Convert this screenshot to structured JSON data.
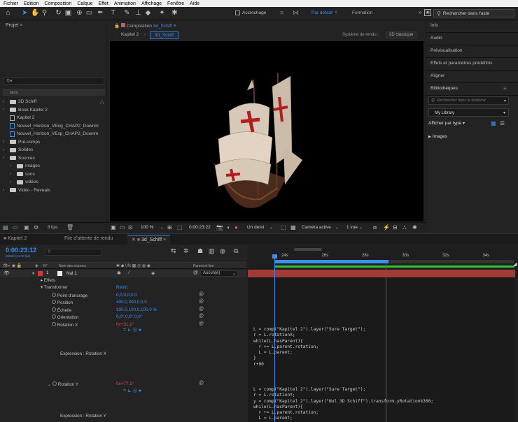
{
  "menu": [
    "Fichier",
    "Edition",
    "Composition",
    "Calque",
    "Effet",
    "Animation",
    "Affichage",
    "Fenêtre",
    "Aide"
  ],
  "toolbar": {
    "snap_label": "Accrochage",
    "workspace_default": "Par défaut",
    "workspace_formation": "Formation",
    "search_placeholder": "Rechercher dans l'aide"
  },
  "project": {
    "title": "Projet",
    "col_name": "Nom",
    "items": [
      {
        "label": "3D Schiff",
        "type": "folder"
      },
      {
        "label": "Book Kapitel 2",
        "type": "folder"
      },
      {
        "label": "Kapitel 2",
        "type": "comp"
      },
      {
        "label": "Nouvel_Horizon_VEng_CHAP2_Downm",
        "type": "file"
      },
      {
        "label": "Nouvel_Horizon_VEsp_CHAP2_Downm",
        "type": "file"
      },
      {
        "label": "Pré-comps",
        "type": "folder"
      },
      {
        "label": "Solides",
        "type": "folder"
      },
      {
        "label": "Sources",
        "type": "folder"
      },
      {
        "label": "images",
        "type": "subfolder"
      },
      {
        "label": "sons",
        "type": "subfolder"
      },
      {
        "label": "vidéos",
        "type": "subfolder"
      },
      {
        "label": "Vidéo - Reveals",
        "type": "folder"
      }
    ],
    "bpc": "8 bpc"
  },
  "composition": {
    "panel_title": "Composition",
    "comp_name": "3d_Schiff",
    "breadcrumb_parent": "Kapitel 2",
    "breadcrumb_current": "3d_Schiff",
    "renderer_label": "Système de rendu :",
    "renderer_value": "3D classique",
    "zoom": "100 %",
    "timecode": "0:00:23:22",
    "resolution": "Un demi",
    "camera": "Caméra active",
    "views": "1 vue"
  },
  "right_panel": {
    "items": [
      "Info",
      "Audio",
      "Prévisualisation",
      "Effets et paramètres prédéfinis",
      "Aligner",
      "Bibliothèques"
    ],
    "lib_search_placeholder": "Rechercher dans la bibliothè",
    "library_select": "My Library",
    "display_by": "Afficher par type",
    "images_label": "Images"
  },
  "timeline": {
    "tabs": [
      "Kapitel 2",
      "File d'attente de rendu",
      "3d_Schiff"
    ],
    "timecode": "0:00:23:12",
    "frame_info": "00563 (24.00 fps)",
    "col_layer": "Nom des sources",
    "col_parent": "Parent et lien",
    "layer_number": "1",
    "layer_name": "Nul 1",
    "parent_value": "Aucun(e)",
    "effects_label": "Effets",
    "transform_label": "Transformer",
    "reset_label": "Réinit.",
    "props": [
      {
        "label": "Point d'ancrage",
        "value": "0,0,0,0,0,0"
      },
      {
        "label": "Position",
        "value": "400,0,300,0,0,0"
      },
      {
        "label": "Échelle",
        "value": "100,0,100,0,100,0 %"
      },
      {
        "label": "Orientation",
        "value": "0,0°,0,0°,0,0°"
      },
      {
        "label": "Rotation X",
        "value": "0x+31,1°"
      }
    ],
    "expression_x_label": "Expression : Rotation X",
    "rotation_y_label": "Rotation Y",
    "rotation_y_value": "0x+77,1°",
    "expression_y_label": "Expression : Rotation Y",
    "ruler": [
      "24s",
      "26s",
      "28s",
      "30s",
      "32s",
      "34s"
    ],
    "code_x": [
      "L = comp(\"Kapitel 2\").layer(\"Sure Target\");",
      "r = L.rotationX;",
      "while(L.hasParent){",
      "  r += L.parent.rotation;",
      "  L = L.parent;",
      "}",
      "r+90"
    ],
    "code_y": [
      "L = comp(\"Kapitel 2\").layer(\"Sure Target\");",
      "r = L.rotationY;",
      "y = comp(\"Kapitel 2\").layer(\"Nul 3D Schiff\").transform.yRotation%360;",
      "while(L.hasParent){",
      "  r += L.parent.rotation;",
      "  L = L.parent;"
    ]
  },
  "colors": {
    "accent": "#3b8ff3",
    "red": "#d53636",
    "bg": "#1d1d1d",
    "panel": "#232323"
  }
}
